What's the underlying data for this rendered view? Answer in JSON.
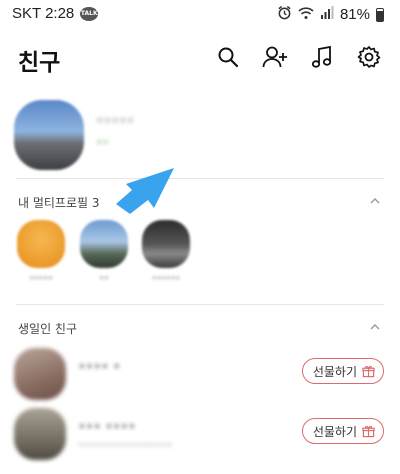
{
  "status_bar": {
    "carrier_time": "SKT 2:28",
    "talk_badge": "TALK",
    "battery": "81%"
  },
  "header": {
    "title": "친구"
  },
  "my_profile": {
    "name": "•••••",
    "status": "••"
  },
  "multi_profile_section": {
    "label": "내 멀티프로필 3",
    "profiles": [
      {
        "label": "•••••",
        "color": "#f0a43a"
      },
      {
        "label": "••",
        "color": "#7aa3cf"
      },
      {
        "label": "••••••",
        "color": "#4a4a4a"
      }
    ]
  },
  "birthday_section": {
    "label": "생일인 친구",
    "friends": [
      {
        "name": "•••• •",
        "sub": "",
        "gift_label": "선물하기"
      },
      {
        "name": "••• ••••",
        "sub": "••••••••••••••••",
        "gift_label": "선물하기"
      }
    ]
  },
  "colors": {
    "arrow": "#3aa3ee",
    "gift_border": "#e06a6a"
  }
}
